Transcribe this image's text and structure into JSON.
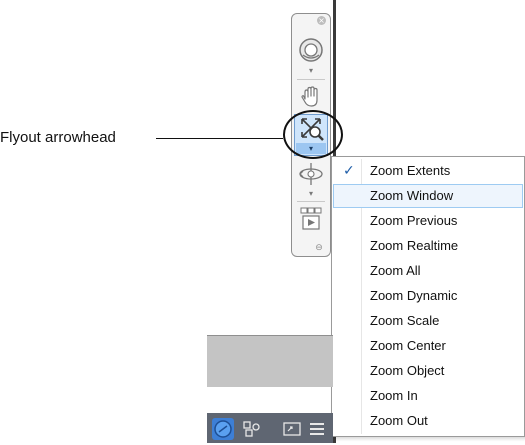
{
  "callout": {
    "label": "Flyout arrowhead"
  },
  "navbar": {
    "close_glyph": "×",
    "buttons": [
      {
        "name": "steeringwheel-icon",
        "arrow": "▾"
      },
      {
        "name": "pan-hand-icon"
      },
      {
        "name": "zoom-extents-icon",
        "arrow": "▾"
      },
      {
        "name": "orbit-icon",
        "arrow": "▾"
      },
      {
        "name": "showmotion-icon"
      }
    ],
    "customize_glyph": "⊖"
  },
  "zoom_menu": {
    "check_glyph": "✓",
    "items": [
      {
        "label": "Zoom Extents",
        "checked": true
      },
      {
        "label": "Zoom Window",
        "hover": true
      },
      {
        "label": "Zoom Previous"
      },
      {
        "label": "Zoom Realtime"
      },
      {
        "label": "Zoom All"
      },
      {
        "label": "Zoom Dynamic"
      },
      {
        "label": "Zoom Scale"
      },
      {
        "label": "Zoom Center"
      },
      {
        "label": "Zoom Object"
      },
      {
        "label": "Zoom In"
      },
      {
        "label": "Zoom Out"
      }
    ]
  },
  "colors": {
    "accent": "#1f5ea8",
    "status_bar": "#5f6672",
    "hover_fill": "#eef5fd",
    "hover_border": "#9ecbf2"
  },
  "status_bar": {
    "icons": [
      "model-status-icon",
      "workspace-switch-icon",
      "fullscreen-icon",
      "customization-menu-icon"
    ]
  }
}
